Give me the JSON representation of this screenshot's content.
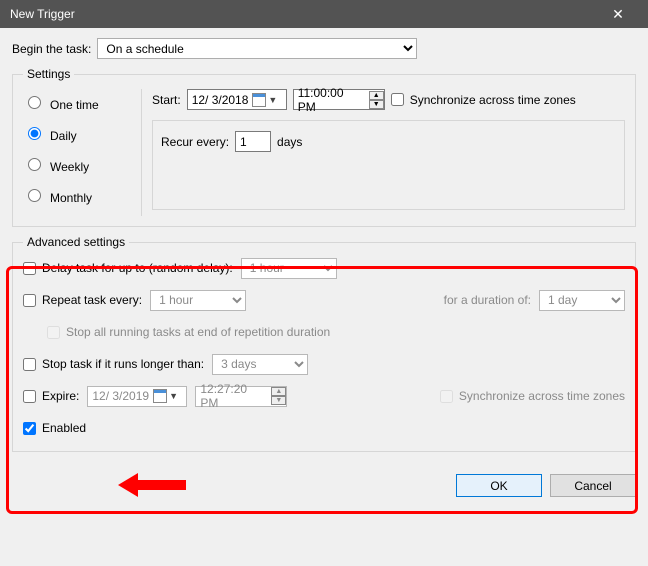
{
  "title": "New Trigger",
  "begin_label": "Begin the task:",
  "begin_value": "On a schedule",
  "settings": {
    "legend": "Settings",
    "radios": {
      "one": "One time",
      "daily": "Daily",
      "weekly": "Weekly",
      "monthly": "Monthly"
    },
    "start_label": "Start:",
    "start_date": "12/  3/2018",
    "start_time": "11:00:00 PM",
    "sync_label": "Synchronize across time zones",
    "recur_label": "Recur every:",
    "recur_value": "1",
    "recur_unit": "days"
  },
  "advanced": {
    "legend": "Advanced settings",
    "delay_label": "Delay task for up to (random delay):",
    "delay_value": "1 hour",
    "repeat_label": "Repeat task every:",
    "repeat_value": "1 hour",
    "duration_label": "for a duration of:",
    "duration_value": "1 day",
    "stop_rep_label": "Stop all running tasks at end of repetition duration",
    "stop_long_label": "Stop task if it runs longer than:",
    "stop_long_value": "3 days",
    "expire_label": "Expire:",
    "expire_date": "12/  3/2019",
    "expire_time": "12:27:20 PM",
    "expire_sync_label": "Synchronize across time zones",
    "enabled_label": "Enabled"
  },
  "buttons": {
    "ok": "OK",
    "cancel": "Cancel"
  }
}
